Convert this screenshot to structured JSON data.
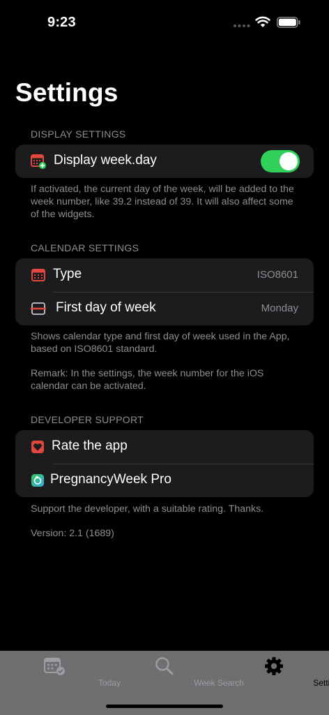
{
  "status_bar": {
    "time": "9:23"
  },
  "page": {
    "title": "Settings"
  },
  "display_settings": {
    "header": "DISPLAY SETTINGS",
    "week_day_label": "Display week.day",
    "week_day_enabled": true,
    "footer": "If activated, the current day of the week, will be added to the week number, like 39.2 instead of 39. It will also affect some of the widgets."
  },
  "calendar_settings": {
    "header": "CALENDAR SETTINGS",
    "type_label": "Type",
    "type_value": "ISO8601",
    "first_day_label": "First day of week",
    "first_day_value": "Monday",
    "footer": "Shows calendar type and first day of week used in the App, based on ISO8601 standard.",
    "remark": "Remark: In the settings, the week number for the iOS calendar can be activated."
  },
  "developer_support": {
    "header": "DEVELOPER SUPPORT",
    "rate_label": "Rate the app",
    "pro_label": "PregnancyWeek Pro",
    "footer": "Support the developer, with a suitable rating. Thanks.",
    "version": "Version: 2.1 (1689)"
  },
  "tab_bar": {
    "tabs": [
      {
        "label": "Today",
        "icon": "calendar-check-icon",
        "active": false
      },
      {
        "label": "Week Search",
        "icon": "magnifier-icon",
        "active": false
      },
      {
        "label": "Settings",
        "icon": "gear-icon",
        "active": true
      }
    ]
  },
  "colors": {
    "background": "#000000",
    "group_background": "#1c1c1e",
    "secondary_text": "#8e8e93",
    "toggle_on": "#30d158",
    "icon_red": "#e5473f",
    "tab_bar": "#6f6f72"
  }
}
